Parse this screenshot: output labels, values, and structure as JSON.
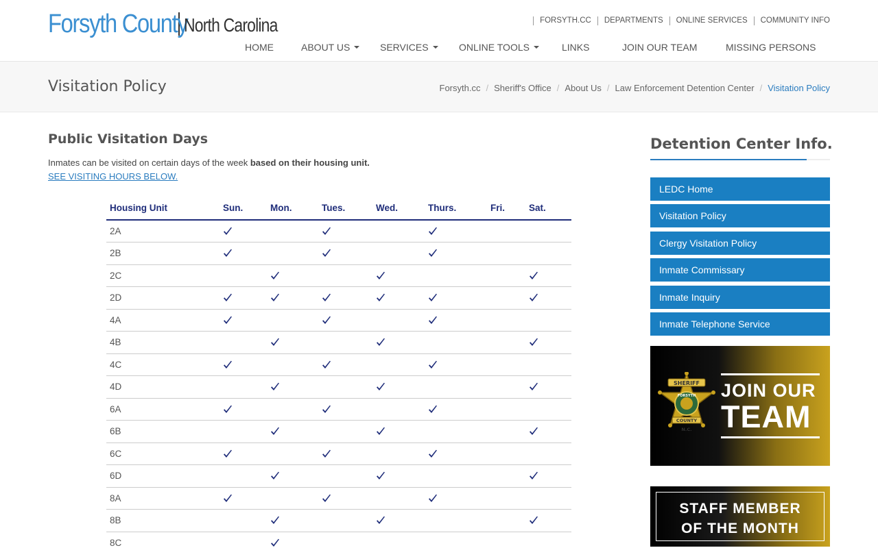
{
  "header": {
    "logo_county": "Forsyth County",
    "logo_state": "North Carolina",
    "util_nav": [
      "FORSYTH.CC",
      "DEPARTMENTS",
      "ONLINE SERVICES",
      "COMMUNITY INFO"
    ],
    "main_nav": {
      "home": "HOME",
      "about": "ABOUT US",
      "services": "SERVICES",
      "online_tools": "ONLINE TOOLS",
      "links": "LINKS",
      "join": "JOIN OUR TEAM",
      "missing": "MISSING PERSONS"
    }
  },
  "titlebar": {
    "title": "Visitation Policy",
    "breadcrumb": [
      "Forsyth.cc",
      "Sheriff's Office",
      "About Us",
      "Law Enforcement Detention Center",
      "Visitation Policy"
    ]
  },
  "content": {
    "section_title": "Public Visitation Days",
    "intro_plain": "Inmates can be visited on certain days of the week ",
    "intro_bold": "based on their housing unit.",
    "see_link": "SEE VISITING HOURS BELOW.",
    "table": {
      "headers": [
        "Housing Unit",
        "Sun.",
        "Mon.",
        "Tues.",
        "Wed.",
        "Thurs.",
        "Fri.",
        "Sat."
      ],
      "rows": [
        {
          "unit": "2A",
          "days": [
            true,
            false,
            true,
            false,
            true,
            false,
            false
          ]
        },
        {
          "unit": "2B",
          "days": [
            true,
            false,
            true,
            false,
            true,
            false,
            false
          ]
        },
        {
          "unit": "2C",
          "days": [
            false,
            true,
            false,
            true,
            false,
            false,
            true
          ]
        },
        {
          "unit": "2D",
          "days": [
            true,
            true,
            true,
            true,
            true,
            false,
            true
          ]
        },
        {
          "unit": "4A",
          "days": [
            true,
            false,
            true,
            false,
            true,
            false,
            false
          ]
        },
        {
          "unit": "4B",
          "days": [
            false,
            true,
            false,
            true,
            false,
            false,
            true
          ]
        },
        {
          "unit": "4C",
          "days": [
            true,
            false,
            true,
            false,
            true,
            false,
            false
          ]
        },
        {
          "unit": "4D",
          "days": [
            false,
            true,
            false,
            true,
            false,
            false,
            true
          ]
        },
        {
          "unit": "6A",
          "days": [
            true,
            false,
            true,
            false,
            true,
            false,
            false
          ]
        },
        {
          "unit": "6B",
          "days": [
            false,
            true,
            false,
            true,
            false,
            false,
            true
          ]
        },
        {
          "unit": "6C",
          "days": [
            true,
            false,
            true,
            false,
            true,
            false,
            false
          ]
        },
        {
          "unit": "6D",
          "days": [
            false,
            true,
            false,
            true,
            false,
            false,
            true
          ]
        },
        {
          "unit": "8A",
          "days": [
            true,
            false,
            true,
            false,
            true,
            false,
            false
          ]
        },
        {
          "unit": "8B",
          "days": [
            false,
            true,
            false,
            true,
            false,
            false,
            true
          ]
        },
        {
          "unit": "8C",
          "days": [
            false,
            true,
            false,
            false,
            false,
            false,
            false
          ]
        }
      ]
    }
  },
  "sidebar": {
    "title": "Detention Center Info.",
    "links": [
      "LEDC Home",
      "Visitation Policy",
      "Clergy Visitation Policy",
      "Inmate Commissary",
      "Inmate Inquiry",
      "Inmate Telephone Service"
    ],
    "banner_join": {
      "line1": "JOIN OUR",
      "line2": "TEAM",
      "badge_text": [
        "SHERIFF",
        "FORSYTH",
        "COUNTY",
        "N.C."
      ]
    },
    "banner_staff": {
      "line1": "STAFF MEMBER",
      "line2": "OF THE MONTH"
    }
  },
  "colors": {
    "brand_blue": "#3b8fd1",
    "link_blue": "#2a7cbf",
    "sidebar_button": "#1a7fc2",
    "table_navy": "#1f2d7a",
    "gold": "#c9a21e"
  }
}
